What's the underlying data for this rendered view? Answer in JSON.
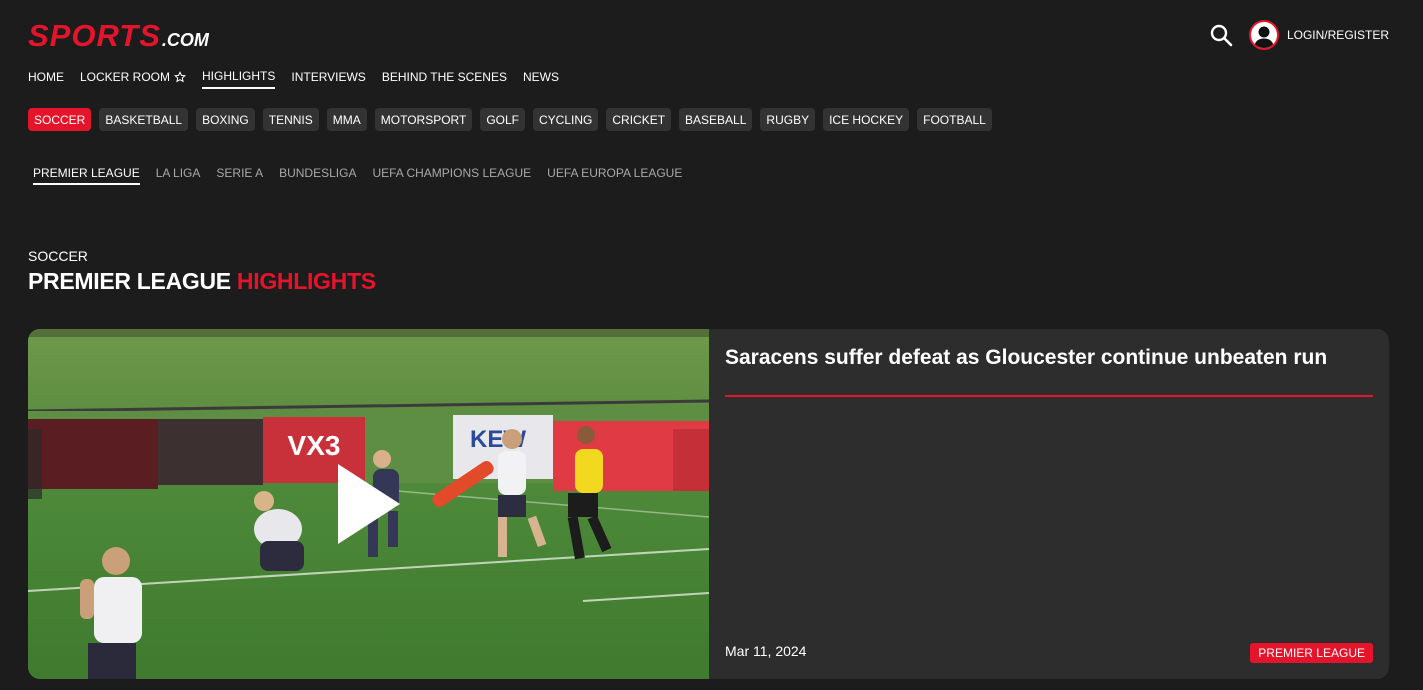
{
  "brand": {
    "name": "SPORTS",
    "suffix": ".COM",
    "accent_color": "#e4142b"
  },
  "header": {
    "search_icon": "search-icon",
    "login_label": "LOGIN/REGISTER"
  },
  "main_nav": [
    {
      "label": "HOME",
      "active": false
    },
    {
      "label": "LOCKER ROOM",
      "active": false,
      "icon": "star-icon"
    },
    {
      "label": "HIGHLIGHTS",
      "active": true
    },
    {
      "label": "INTERVIEWS",
      "active": false
    },
    {
      "label": "BEHIND THE SCENES",
      "active": false
    },
    {
      "label": "NEWS",
      "active": false
    }
  ],
  "sports": [
    {
      "label": "SOCCER",
      "active": true
    },
    {
      "label": "BASKETBALL"
    },
    {
      "label": "BOXING"
    },
    {
      "label": "TENNIS"
    },
    {
      "label": "MMA"
    },
    {
      "label": "MOTORSPORT"
    },
    {
      "label": "GOLF"
    },
    {
      "label": "CYCLING"
    },
    {
      "label": "CRICKET"
    },
    {
      "label": "BASEBALL"
    },
    {
      "label": "RUGBY"
    },
    {
      "label": "ICE HOCKEY"
    },
    {
      "label": "FOOTBALL"
    }
  ],
  "leagues": [
    {
      "label": "PREMIER LEAGUE",
      "active": true
    },
    {
      "label": "LA LIGA"
    },
    {
      "label": "SERIE A"
    },
    {
      "label": "BUNDESLIGA"
    },
    {
      "label": "UEFA CHAMPIONS LEAGUE"
    },
    {
      "label": "UEFA EUROPA LEAGUE"
    }
  ],
  "section": {
    "sport": "SOCCER",
    "title_main": "PREMIER LEAGUE",
    "title_accent": "HIGHLIGHTS"
  },
  "featured": {
    "title": "Saracens suffer defeat as Gloucester continue unbeaten run",
    "date": "Mar 11, 2024",
    "badge": "PREMIER LEAGUE",
    "play_icon": "play-icon",
    "thumbnail": {
      "board_texts": [
        "VX3",
        "KEW"
      ]
    }
  }
}
